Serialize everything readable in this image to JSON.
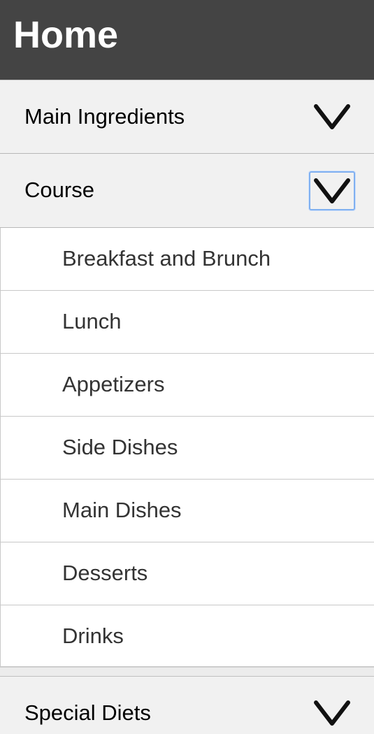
{
  "header": {
    "title": "Home"
  },
  "sections": {
    "main_ingredients": {
      "label": "Main Ingredients",
      "toggle_icon": "chevron-down-icon"
    },
    "course": {
      "label": "Course",
      "toggle_icon": "chevron-down-icon",
      "items": [
        {
          "label": "Breakfast and Brunch"
        },
        {
          "label": "Lunch"
        },
        {
          "label": "Appetizers"
        },
        {
          "label": "Side Dishes"
        },
        {
          "label": "Main Dishes"
        },
        {
          "label": "Desserts"
        },
        {
          "label": "Drinks"
        }
      ]
    },
    "special_diets": {
      "label": "Special Diets",
      "toggle_icon": "chevron-down-icon"
    }
  },
  "colors": {
    "header_bg": "#444444",
    "section_bg": "#f1f1f1",
    "focus_ring": "#80b0f0"
  }
}
